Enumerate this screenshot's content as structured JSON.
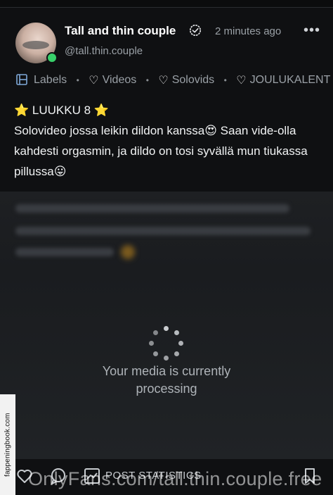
{
  "post": {
    "author_name": "Tall and thin couple",
    "handle": "@tall.thin.couple",
    "time_ago": "2 minutes ago",
    "more": "•••"
  },
  "labels": {
    "title": "Labels",
    "items": [
      "Videos",
      "Solovids",
      "JOULUKALENT"
    ]
  },
  "body": {
    "line1": "⭐ LUUKKU 8 ⭐",
    "line2": "Solovideo jossa leikin dildon kanssa😍 Saan vide-olla kahdesti orgasmin, ja dildo on tosi syvällä mun tiukassa pillussa😛"
  },
  "media": {
    "status": "Your media is currently processing"
  },
  "actions": {
    "stats_label": "POST STATISTICS"
  },
  "watermarks": {
    "side": "fappeningbook.com",
    "bottom": "OnlyFans.com/tall.thin.couple.free"
  }
}
